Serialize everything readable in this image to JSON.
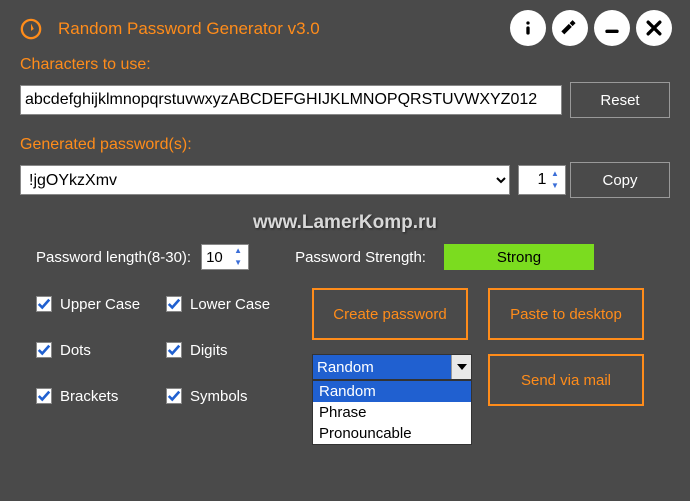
{
  "header": {
    "title": "Random Password Generator v3.0"
  },
  "labels": {
    "chars_to_use": "Characters to use:",
    "generated": "Generated password(s):",
    "reset": "Reset",
    "copy": "Copy",
    "pwd_length": "Password length(8-30):",
    "pwd_strength": "Password Strength:",
    "create": "Create password",
    "paste_desktop": "Paste to desktop",
    "send_mail": "Send via mail"
  },
  "values": {
    "chars": "abcdefghijklmnopqrstuvwxyzABCDEFGHIJKLMNOPQRSTUVWXYZ012",
    "password": "!jgOYkzXmv",
    "count": "1",
    "length": "10",
    "strength": "Strong",
    "watermark": "www.LamerKomp.ru"
  },
  "checks": {
    "upper": "Upper Case",
    "lower": "Lower Case",
    "dots": "Dots",
    "digits": "Digits",
    "brackets": "Brackets",
    "symbols": "Symbols"
  },
  "type_dd": {
    "selected": "Random",
    "options": [
      "Random",
      "Phrase",
      "Pronouncable"
    ]
  }
}
